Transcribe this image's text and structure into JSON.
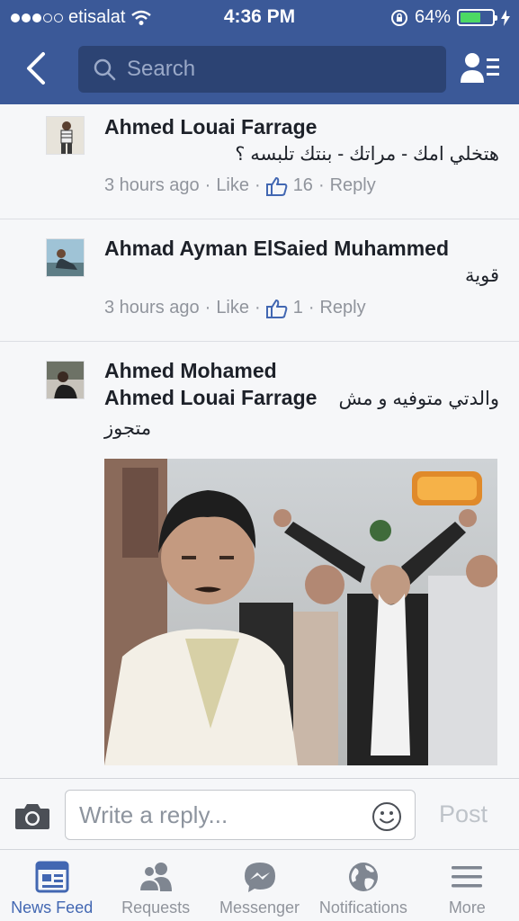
{
  "status_bar": {
    "carrier": "etisalat",
    "time": "4:36 PM",
    "battery": "64%",
    "battery_level": 0.64
  },
  "nav": {
    "search_placeholder": "Search"
  },
  "comments": [
    {
      "author": "Ahmed Louai Farrage",
      "text": "هتخلي امك - مراتك - بنتك تلبسه ؟",
      "time": "3 hours ago",
      "like_label": "Like",
      "like_count": "16",
      "reply_label": "Reply"
    },
    {
      "author": "Ahmad Ayman ElSaied Muhammed",
      "text": "قوية",
      "time": "3 hours ago",
      "like_label": "Like",
      "like_count": "1",
      "reply_label": "Reply"
    },
    {
      "author": "Ahmed Mohamed",
      "mention": "Ahmed Louai Farrage",
      "text_line1": "والدتي متوفيه و مش",
      "text_line2": "متجوز"
    }
  ],
  "reply_bar": {
    "placeholder": "Write a reply...",
    "post_label": "Post"
  },
  "tabs": [
    {
      "label": "News Feed",
      "icon": "news-feed-icon",
      "active": true
    },
    {
      "label": "Requests",
      "icon": "friend-requests-icon",
      "active": false
    },
    {
      "label": "Messenger",
      "icon": "messenger-icon",
      "active": false
    },
    {
      "label": "Notifications",
      "icon": "globe-icon",
      "active": false
    },
    {
      "label": "More",
      "icon": "hamburger-icon",
      "active": false
    }
  ],
  "colors": {
    "brand": "#3b5998",
    "active_tab": "#4267b2",
    "battery": "#4cd964"
  }
}
